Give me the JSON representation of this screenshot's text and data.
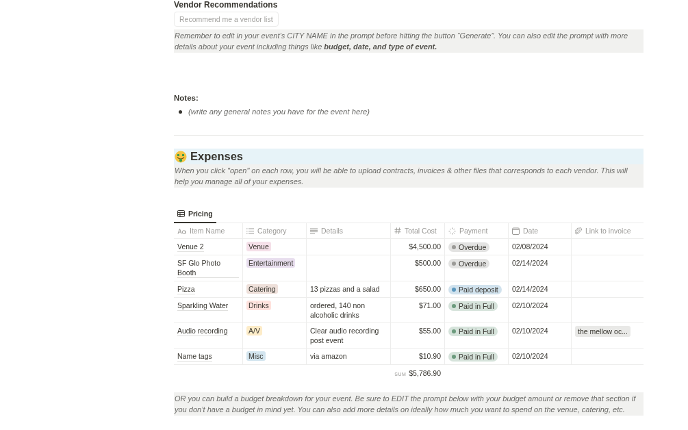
{
  "vendor_section": {
    "heading": "Vendor Recommendations",
    "button": "Recommend me a vendor list",
    "callout": "Remember to edit in your event’s CITY NAME in the prompt before hitting the button “Generate”. You can also edit the prompt with more details about your event including things like **budget, date, and type of event.**"
  },
  "notes": {
    "heading": "Notes:",
    "items": [
      "(write any general notes you have for the event here)"
    ]
  },
  "expenses": {
    "heading": "Expenses",
    "callout": "When you click \"open\" on each row, you will be able to upload contracts, invoices & other files that corresponds to each vendor. This will help you manage all of your expenses."
  },
  "database": {
    "tabs": [
      {
        "label": "Pricing",
        "selected": true
      }
    ],
    "columns": [
      {
        "label": "Item Name",
        "kind": "title"
      },
      {
        "label": "Category",
        "kind": "select"
      },
      {
        "label": "Details",
        "kind": "text"
      },
      {
        "label": "Total Cost",
        "kind": "number"
      },
      {
        "label": "Payment",
        "kind": "status"
      },
      {
        "label": "Date",
        "kind": "date"
      },
      {
        "label": "Link to invoice",
        "kind": "file"
      }
    ],
    "rows": [
      {
        "name": "Venue 2",
        "category": {
          "label": "Venue",
          "color": "#f5e0e9"
        },
        "details": "",
        "cost": "$4,500.00",
        "payment": {
          "label": "Overdue",
          "color": "#9b9a97"
        },
        "date": "02/08/2024",
        "link": ""
      },
      {
        "name": "SF Glo Photo Booth",
        "category": {
          "label": "Entertainment",
          "color": "#e8deee"
        },
        "details": "",
        "cost": "$500.00",
        "payment": {
          "label": "Overdue",
          "color": "#9b9a97"
        },
        "date": "02/14/2024",
        "link": ""
      },
      {
        "name": "Pizza",
        "category": {
          "label": "Catering",
          "color": "#eee0da"
        },
        "details": "13 pizzas and a salad",
        "cost": "$650.00",
        "payment": {
          "label": "Paid deposit",
          "color": "#5b97bd"
        },
        "date": "02/14/2024",
        "link": ""
      },
      {
        "name": "Sparkling Water",
        "category": {
          "label": "Drinks",
          "color": "#ffe2dd"
        },
        "details": "ordered, 140 non alcoholic drinks",
        "cost": "$71.00",
        "payment": {
          "label": "Paid in Full",
          "color": "#6c9b7d"
        },
        "date": "02/10/2024",
        "link": ""
      },
      {
        "name": "Audio recording",
        "category": {
          "label": "A/V",
          "color": "#fdecc8"
        },
        "details": "Clear audio recording post event",
        "cost": "$55.00",
        "payment": {
          "label": "Paid in Full",
          "color": "#6c9b7d"
        },
        "date": "02/10/2024",
        "link": "the mellow oc..."
      },
      {
        "name": "Name tags",
        "category": {
          "label": "Misc",
          "color": "#d3e5ef"
        },
        "details": "via amazon",
        "cost": "$10.90",
        "payment": {
          "label": "Paid in Full",
          "color": "#6c9b7d"
        },
        "date": "02/10/2024",
        "link": ""
      }
    ],
    "sum_label": "SUM",
    "sum": "$5,786.90"
  },
  "budget_callout": "OR you can build a budget breakdown for your event. Be sure to EDIT the prompt below with your budget amount or remove that section if you don’t have a budget in mind yet. You can also add more details on ideally how much you want to spend on the venue, catering, etc."
}
